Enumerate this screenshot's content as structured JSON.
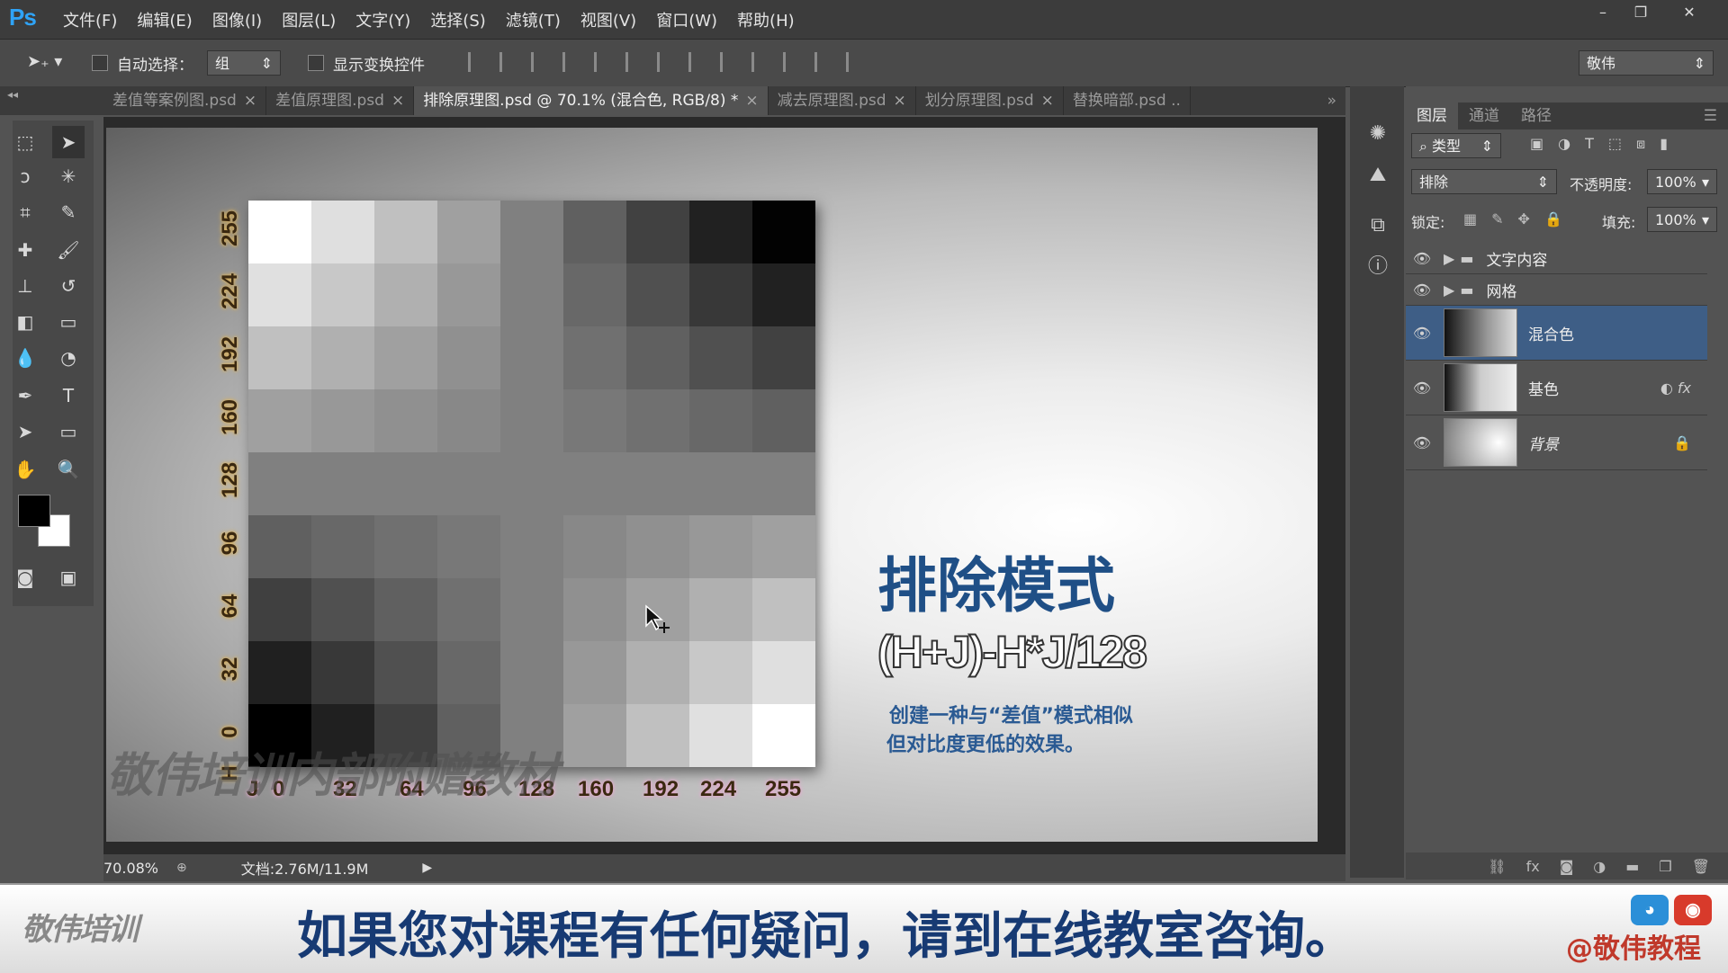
{
  "app": {
    "logo": "Ps",
    "menu": [
      "文件(F)",
      "编辑(E)",
      "图像(I)",
      "图层(L)",
      "文字(Y)",
      "选择(S)",
      "滤镜(T)",
      "视图(V)",
      "窗口(W)",
      "帮助(H)"
    ]
  },
  "options_bar": {
    "auto_select_label": "自动选择：",
    "auto_select_value": "组",
    "show_transform_label": "显示变换控件",
    "workspace": "敬伟"
  },
  "tabs": [
    {
      "label": "差值等案例图.psd",
      "active": false
    },
    {
      "label": "差值原理图.psd",
      "active": false
    },
    {
      "label": "排除原理图.psd @ 70.1% (混合色, RGB/8) *",
      "active": true
    },
    {
      "label": "减去原理图.psd",
      "active": false
    },
    {
      "label": "划分原理图.psd",
      "active": false
    },
    {
      "label": "替换暗部.psd ..",
      "active": false
    }
  ],
  "canvas": {
    "y_axis_label": "H",
    "x_axis_label": "J",
    "y_ticks": [
      "255",
      "224",
      "192",
      "160",
      "128",
      "96",
      "64",
      "32",
      "0"
    ],
    "x_ticks": [
      "0",
      "32",
      "64",
      "96",
      "128",
      "160",
      "192",
      "224",
      "255"
    ],
    "watermark": "敬伟培训内部附赠教材",
    "title": "排除模式",
    "formula": "(H+J)-H*J/128",
    "desc_line1": "创建一种与“差值”模式相似",
    "desc_line2": "但对比度更低的效果。"
  },
  "status": {
    "zoom": "70.08%",
    "doc": "文档:2.76M/11.9M"
  },
  "layers_panel": {
    "tabs": [
      "图层",
      "通道",
      "路径"
    ],
    "filter_kind": "类型",
    "blend_mode": "排除",
    "opacity_label": "不透明度:",
    "opacity": "100%",
    "lock_label": "锁定:",
    "fill_label": "填充:",
    "fill": "100%",
    "layers": [
      {
        "name": "文字内容",
        "type": "group"
      },
      {
        "name": "网格",
        "type": "group"
      },
      {
        "name": "混合色",
        "type": "layer",
        "selected": true
      },
      {
        "name": "基色",
        "type": "layer",
        "fx": true
      },
      {
        "name": "背景",
        "type": "background",
        "locked": true
      }
    ]
  },
  "banner": {
    "logo": "敬伟培训",
    "message": "如果您对课程有任何疑问，请到在线教室咨询。",
    "handle": "@敬伟教程"
  },
  "colors": {
    "title_blue": "#1f4f86",
    "selected_layer": "#3e5e86",
    "ps_blue": "#2fa3f6"
  }
}
